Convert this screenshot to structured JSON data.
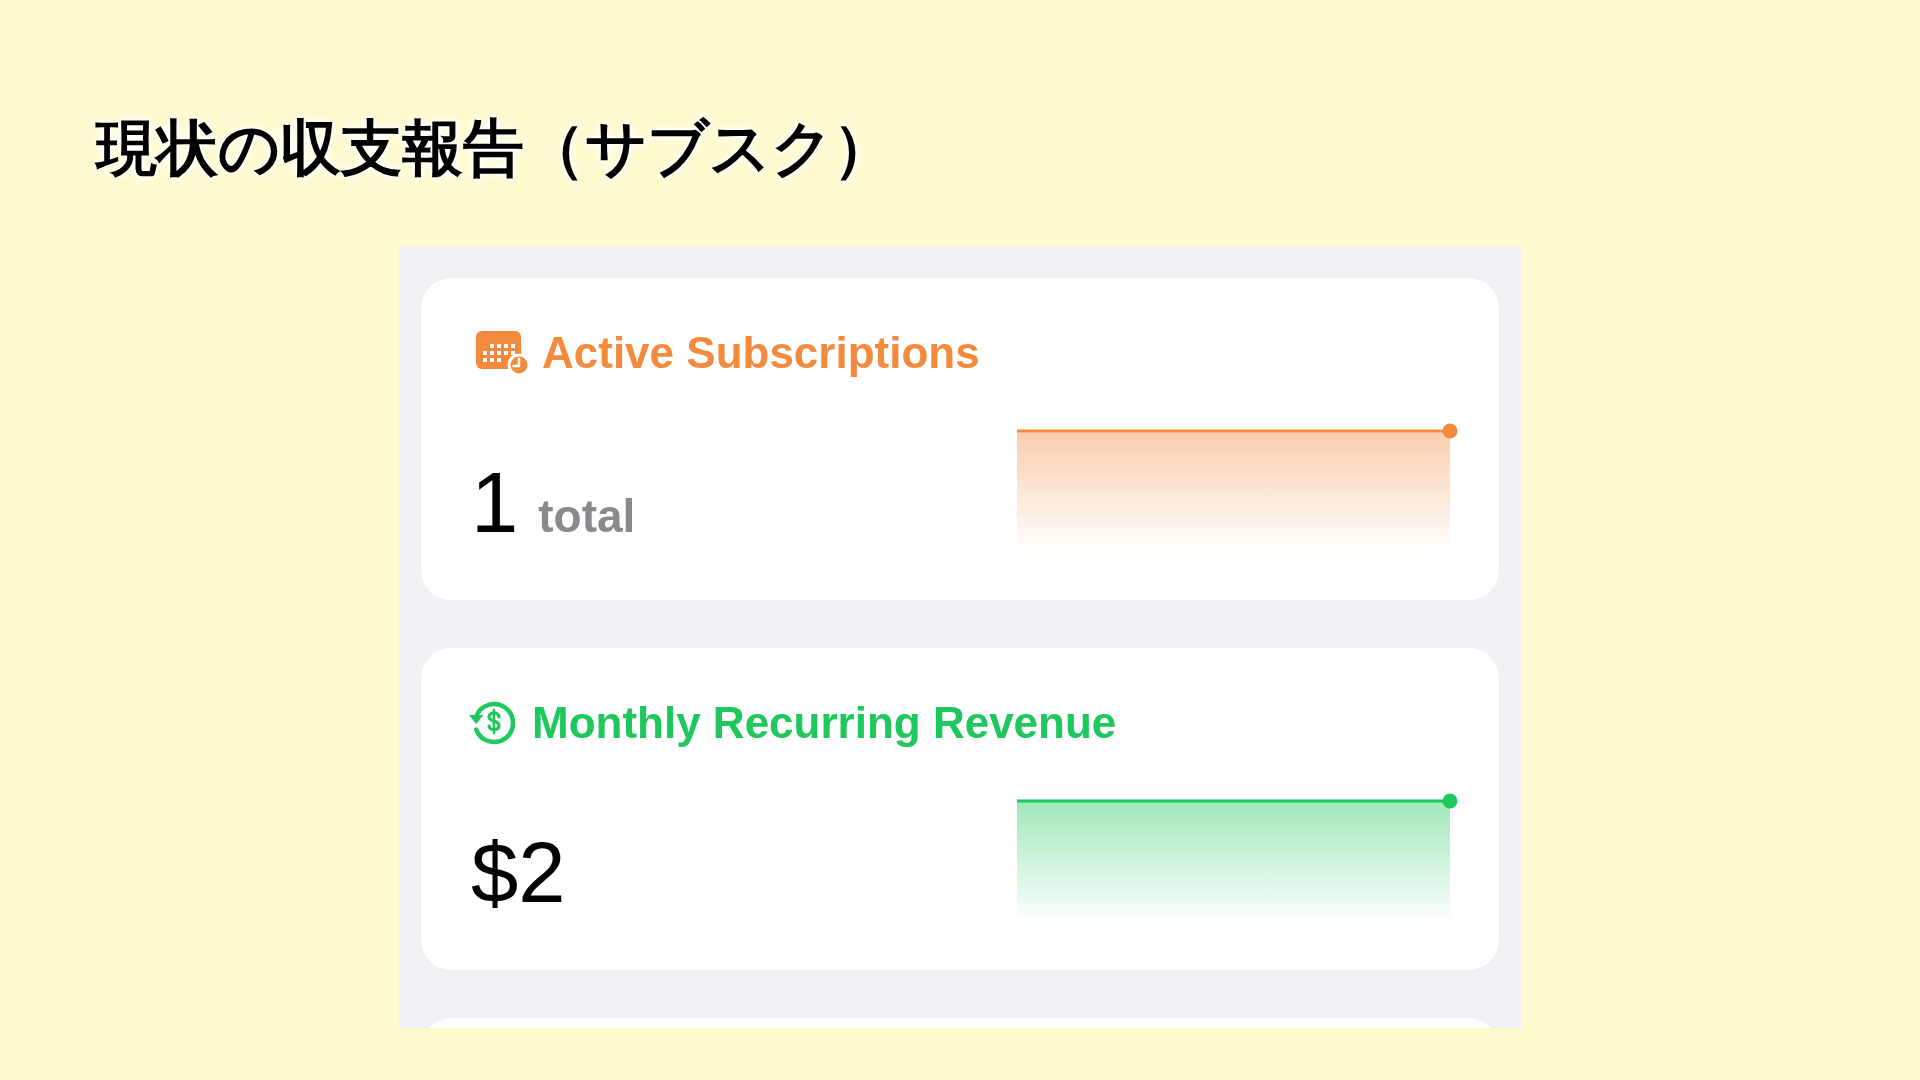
{
  "title": "現状の収支報告（サブスク）",
  "cards": [
    {
      "kind": "count",
      "title": "Active Subscriptions",
      "color": "#f38a3e",
      "value": "1",
      "unit": "total"
    },
    {
      "kind": "money",
      "title": "Monthly Recurring Revenue",
      "color": "#1ec85c",
      "value": "$2"
    }
  ]
}
